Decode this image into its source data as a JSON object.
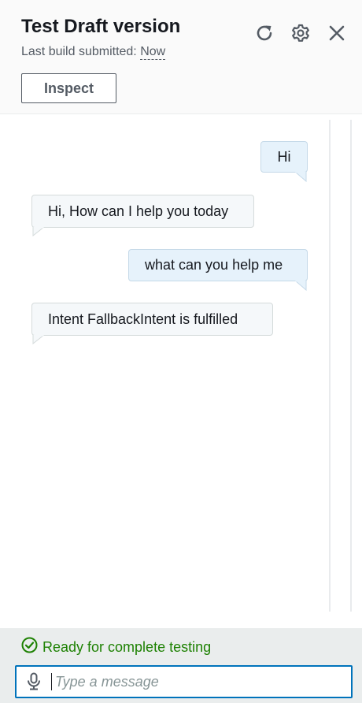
{
  "header": {
    "title": "Test Draft version",
    "subtitle_label": "Last build submitted:",
    "subtitle_value": "Now",
    "inspect_label": "Inspect",
    "icons": [
      "refresh-icon",
      "settings-gear-icon",
      "close-icon"
    ]
  },
  "messages": [
    {
      "sender": "user",
      "text": "Hi"
    },
    {
      "sender": "bot",
      "text": "Hi, How can I help you today"
    },
    {
      "sender": "user",
      "text": "what can you help me"
    },
    {
      "sender": "bot",
      "text": "Intent FallbackIntent is fulfilled"
    }
  ],
  "status": {
    "text": "Ready for complete testing",
    "color": "#1d8102"
  },
  "input": {
    "placeholder": "Type a message",
    "value": "",
    "icon": "microphone-icon"
  },
  "colors": {
    "accent": "#0073bb",
    "user_bubble": "#e6f2fb",
    "bot_bubble": "#f5f8fa"
  }
}
